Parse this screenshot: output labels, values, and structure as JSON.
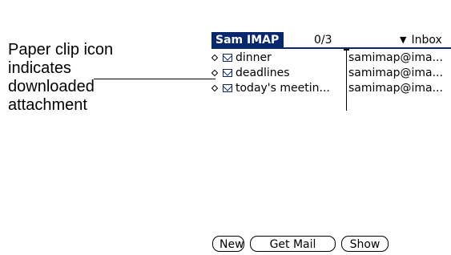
{
  "annotation": {
    "lines": [
      "Paper clip icon",
      "indicates",
      "downloaded",
      "attachment"
    ]
  },
  "app": {
    "title": "Sam IMAP",
    "message_count": "0/3",
    "folder": "Inbox",
    "folder_icon": "triangle-down-icon",
    "accent_color": "#08286d"
  },
  "messages": [
    {
      "subject": "dinner",
      "from": "samimap@ima..."
    },
    {
      "subject": "deadlines",
      "from": "samimap@ima..."
    },
    {
      "subject": "today's meetin...",
      "from": "samimap@ima..."
    }
  ],
  "buttons": {
    "new": "New",
    "get_mail": "Get Mail",
    "show": "Show"
  }
}
